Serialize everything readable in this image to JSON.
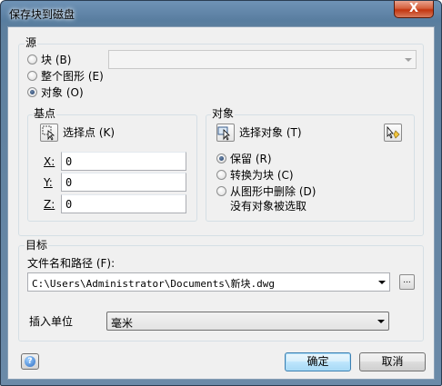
{
  "window": {
    "title": "保存块到磁盘",
    "close_label": "X"
  },
  "source": {
    "group_label": "源",
    "block_label": "块 (B)",
    "block_key": "B",
    "whole_drawing_label": "整个图形 (E)",
    "whole_drawing_key": "E",
    "objects_label": "对象 (O)",
    "objects_key": "O",
    "selected": "objects",
    "block_combo_value": ""
  },
  "base_point": {
    "group_label": "基点",
    "pick_label": "选择点 (K)",
    "x_label": "X:",
    "y_label": "Y:",
    "z_label": "Z:",
    "x_value": "0",
    "y_value": "0",
    "z_value": "0"
  },
  "objects": {
    "group_label": "对象",
    "select_label": "选择对象 (T)",
    "retain_label": "保留 (R)",
    "convert_label": "转换为块 (C)",
    "delete_label": "从图形中删除 (D)",
    "selected": "retain",
    "status_text": "没有对象被选取"
  },
  "destination": {
    "group_label": "目标",
    "filename_label": "文件名和路径 (F):",
    "path_value": "C:\\Users\\Administrator\\Documents\\新块.dwg",
    "browse_label": "...",
    "units_label": "插入单位",
    "units_value": "毫米"
  },
  "footer": {
    "ok_label": "确定",
    "cancel_label": "取消",
    "help_symbol": "?"
  }
}
